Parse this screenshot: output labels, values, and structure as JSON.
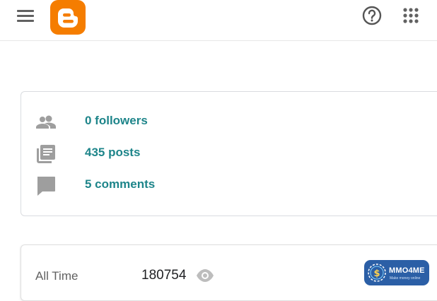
{
  "header": {
    "menu_icon": "hamburger-menu-icon",
    "logo_icon": "blogger-logo",
    "help_icon": "help-circle-icon",
    "apps_icon": "apps-grid-icon",
    "brand_color": "#f57d00"
  },
  "stats": {
    "items": [
      {
        "icon": "people-icon",
        "label": "0 followers"
      },
      {
        "icon": "posts-library-icon",
        "label": "435 posts"
      },
      {
        "icon": "comment-icon",
        "label": "5 comments"
      }
    ],
    "link_color": "#1e858a"
  },
  "views": {
    "period_label": "All Time",
    "count": "180754",
    "icon": "eye-icon"
  },
  "badge": {
    "brand": "MMO4ME",
    "tagline": "Make money online",
    "color": "#2b5fa6"
  }
}
